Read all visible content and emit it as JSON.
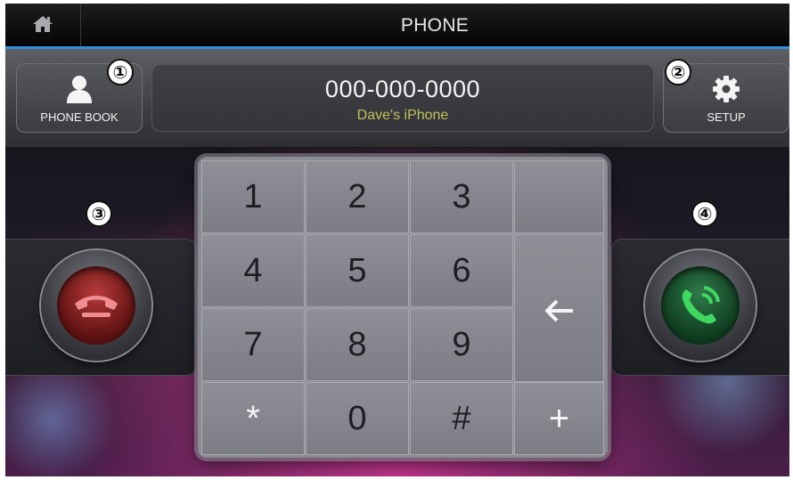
{
  "topbar": {
    "title": "PHONE",
    "home_icon": "home-icon"
  },
  "header": {
    "phonebook": {
      "label": "PHONE BOOK",
      "icon": "person-icon"
    },
    "setup": {
      "label": "SETUP",
      "icon": "gear-icon"
    },
    "display": {
      "number": "000-000-0000",
      "device": "Dave's iPhone"
    }
  },
  "callouts": [
    "①",
    "②",
    "③",
    "④"
  ],
  "keypad": {
    "keys": [
      "1",
      "2",
      "3",
      "4",
      "5",
      "6",
      "7",
      "8",
      "9",
      "*",
      "0",
      "#",
      "+"
    ],
    "backspace_icon": "arrow-left-icon"
  },
  "buttons": {
    "end_call_icon": "hang-up-icon",
    "start_call_icon": "call-icon"
  },
  "colors": {
    "accent_line": "#2d8fe0",
    "device_text": "#c2c25a",
    "end_call": "#d9535b",
    "start_call": "#2fbf4f"
  }
}
